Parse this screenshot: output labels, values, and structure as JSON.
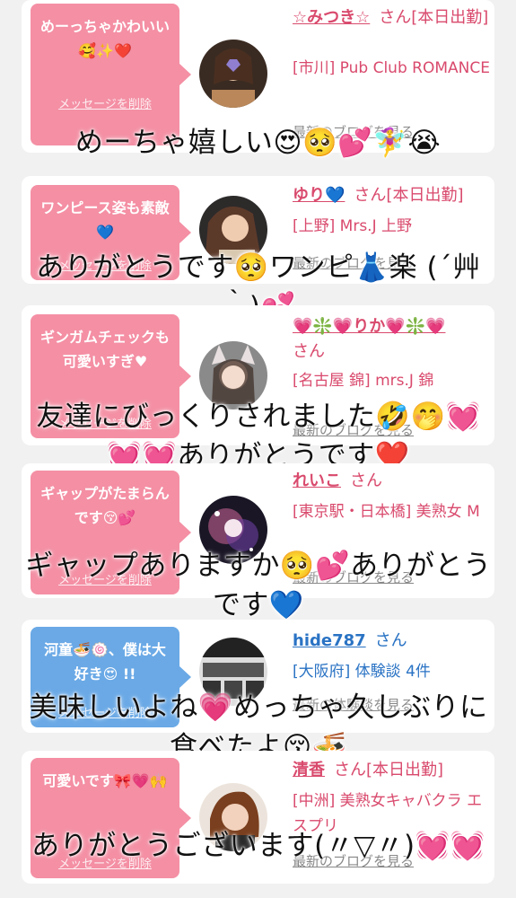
{
  "cards": [
    {
      "bubble": "めーっちゃかわいい🥰✨❤️",
      "delete_label": "メッセージを削除",
      "name": "☆みつき☆",
      "san": "さん[本日出勤]",
      "shop": "[市川] Pub Club ROMANCE",
      "blog": "最新のブログを見る",
      "reply": "めーちゃ嬉しい😍🥺💕🧚‍♀️😭"
    },
    {
      "bubble": "ワンピース姿も素敵💙",
      "delete_label": "メッセージを削除",
      "name": "ゆり💙",
      "san": "さん[本日出勤]",
      "shop": "[上野] Mrs.J 上野",
      "blog": "最新のブログを見る",
      "reply": "ありがとうです🥺ワンピ👗楽 (´艸｀)💕"
    },
    {
      "bubble": "ギンガムチェックも可愛いすぎ♥",
      "delete_label": "メッセージを削除",
      "name": "💗❇️💗りか💗❇️💗",
      "san": "さん",
      "shop": "[名古屋 錦] mrs.J 錦",
      "blog": "最新のブログを見る",
      "reply": "友達にびっくりされました🤣🤭💓💓💓ありがとうです❤️"
    },
    {
      "bubble": "ギャップがたまらんです😚💕",
      "delete_label": "メッセージを削除",
      "name": "れいこ",
      "san": "さん",
      "shop": "[東京駅・日本橋] 美熟女 M",
      "blog": "最新のブログを見る",
      "reply": "ギャップありますか🥺💕ありがとうです💙"
    },
    {
      "bubble": "河童🍜🍥、僕は大好き😍 !!",
      "delete_label": "メッセージを削除",
      "name": "hide787",
      "san": "さん",
      "shop": "[大阪府] 体験談 4件",
      "blog": "最新の体験談を見る",
      "reply": "美味しいよね💗めっちゃ久しぶりに食べたよ😚🍜"
    },
    {
      "bubble": "可愛いです🎀💗🙌",
      "delete_label": "メッセージを削除",
      "name": "清香",
      "san": "さん[本日出勤]",
      "shop": "[中洲] 美熟女キャバクラ エスプリ",
      "blog": "最新のブログを見る",
      "reply": "ありがとうございます(〃▽〃)💓💓"
    }
  ],
  "colors": {
    "pink": "#f48fa4",
    "blue": "#6aa9e6",
    "name_pink": "#d94a6d",
    "name_blue": "#2a73c4"
  }
}
